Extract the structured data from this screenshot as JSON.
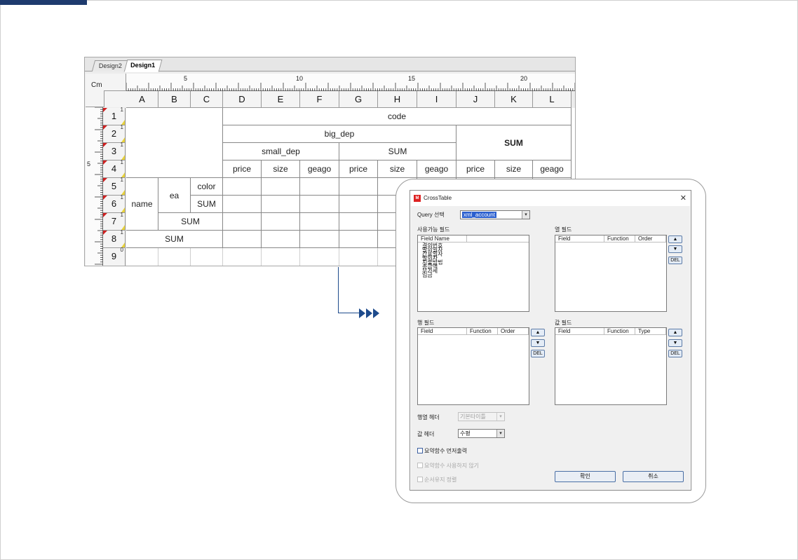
{
  "designer": {
    "tabs": [
      "Design2",
      "Design1"
    ],
    "active_tab": "Design1",
    "unit_label": "Cm",
    "h_ruler_marks": [
      "5",
      "10",
      "15",
      "20"
    ],
    "v_ruler_marks": [
      "5"
    ],
    "columns": [
      "A",
      "B",
      "C",
      "D",
      "E",
      "F",
      "G",
      "H",
      "I",
      "J",
      "K",
      "L"
    ],
    "rows": [
      {
        "num": "1",
        "level": "1"
      },
      {
        "num": "2",
        "level": "1"
      },
      {
        "num": "3",
        "level": "1"
      },
      {
        "num": "4",
        "level": "1"
      },
      {
        "num": "5",
        "level": "1"
      },
      {
        "num": "6",
        "level": "1"
      },
      {
        "num": "7",
        "level": "1"
      },
      {
        "num": "8",
        "level": "1"
      },
      {
        "num": "9",
        "level": "0"
      }
    ],
    "cells": {
      "code": "code",
      "big_dep": "big_dep",
      "small_dep": "small_dep",
      "sum_g3": "SUM",
      "sum_j2": "SUM",
      "d4": "price",
      "e4": "size",
      "f4": "geago",
      "g4": "price",
      "h4": "size",
      "i4": "geago",
      "j4": "price",
      "k4": "size",
      "l4": "geago",
      "name": "name",
      "ea": "ea",
      "color": "color",
      "sum_c6": "SUM",
      "sum_b7": "SUM",
      "sum_a8": "SUM"
    }
  },
  "dialog": {
    "title": "CrossTable",
    "app_icon": "M",
    "close": "✕",
    "query_label": "Query 선택",
    "query_value": "xml_account",
    "available_label": "사용가능 필드",
    "available_header": "Field Name",
    "available_items": [
      "결의번호",
      "발의일자",
      "간표일자",
      "발의자",
      "지출방법",
      "총금액",
      "부가세",
      "입금"
    ],
    "column_fields_label": "열 필드",
    "column_fields_headers": [
      "Field",
      "Function",
      "Order"
    ],
    "row_fields_label": "행 필드",
    "row_fields_headers": [
      "Field",
      "Function",
      "Order"
    ],
    "value_fields_label": "값 필드",
    "value_fields_headers": [
      "Field",
      "Function",
      "Type"
    ],
    "up": "▲",
    "down": "▼",
    "del": "DEL",
    "rowcol_header_label": "행열 헤더",
    "rowcol_header_value": "기본타이틀",
    "value_header_label": "값 헤더",
    "value_header_value": "수평",
    "checks": [
      {
        "label": "요약함수 먼저출력",
        "enabled": true
      },
      {
        "label": "요약함수 사용하지 않기",
        "enabled": false
      },
      {
        "label": "순서유지 정렬",
        "enabled": false
      }
    ],
    "ok": "확인",
    "cancel": "취소"
  }
}
